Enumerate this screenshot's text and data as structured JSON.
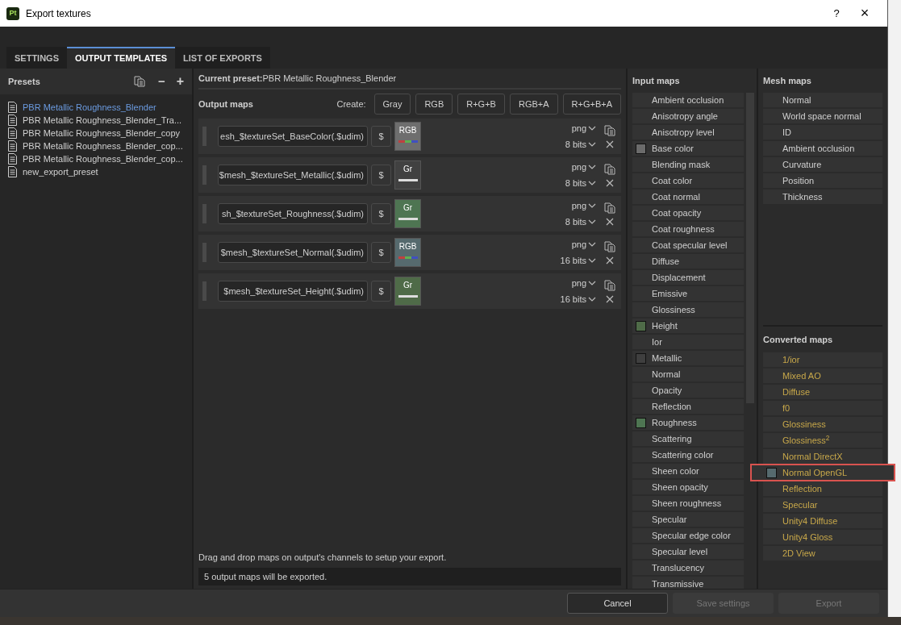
{
  "window": {
    "app_badge": "Pt",
    "title": "Export textures",
    "help": "?",
    "close": "×"
  },
  "tabs": [
    {
      "label": "SETTINGS",
      "selected": false
    },
    {
      "label": "OUTPUT TEMPLATES",
      "selected": true
    },
    {
      "label": "LIST OF EXPORTS",
      "selected": false
    }
  ],
  "presets": {
    "title": "Presets",
    "minus": "−",
    "plus": "+",
    "items": [
      {
        "label": "PBR Metallic Roughness_Blender",
        "selected": true
      },
      {
        "label": "PBR Metallic Roughness_Blender_Tra...",
        "selected": false
      },
      {
        "label": "PBR Metallic Roughness_Blender_copy",
        "selected": false
      },
      {
        "label": "PBR Metallic Roughness_Blender_cop...",
        "selected": false
      },
      {
        "label": "PBR Metallic Roughness_Blender_cop...",
        "selected": false
      },
      {
        "label": "new_export_preset",
        "selected": false
      }
    ]
  },
  "current_preset": {
    "label": "Current preset:",
    "value": "PBR Metallic Roughness_Blender"
  },
  "output_maps": {
    "title": "Output maps",
    "create_label": "Create:",
    "create_buttons": [
      "Gray",
      "RGB",
      "R+G+B",
      "RGB+A",
      "R+G+B+A"
    ],
    "maps": [
      {
        "name": "esh_$textureSet_BaseColor(.$udim)",
        "dollar": "$",
        "kind": "rgb",
        "channel": "RGB",
        "color": "#6e6e6e",
        "format": "png",
        "bits": "8 bits"
      },
      {
        "name": "$mesh_$textureSet_Metallic(.$udim)",
        "dollar": "$",
        "kind": "gray",
        "channel": "Gr",
        "color": "#414141",
        "format": "png",
        "bits": "8 bits"
      },
      {
        "name": "sh_$textureSet_Roughness(.$udim)",
        "dollar": "$",
        "kind": "gray",
        "channel": "Gr",
        "color": "#4e7552",
        "format": "png",
        "bits": "8 bits"
      },
      {
        "name": "$mesh_$textureSet_Normal(.$udim)",
        "dollar": "$",
        "kind": "rgb",
        "channel": "RGB",
        "color": "#566a6e",
        "format": "png",
        "bits": "16 bits"
      },
      {
        "name": "$mesh_$textureSet_Height(.$udim)",
        "dollar": "$",
        "kind": "gray",
        "channel": "Gr",
        "color": "#4f6b48",
        "format": "png",
        "bits": "16 bits"
      }
    ],
    "hint": "Drag and drop maps on output's channels to setup your export.",
    "status": "5 output maps will be exported."
  },
  "input_maps": {
    "title": "Input maps",
    "items": [
      {
        "label": "Ambient occlusion"
      },
      {
        "label": "Anisotropy angle"
      },
      {
        "label": "Anisotropy level"
      },
      {
        "label": "Base color",
        "color": "#6b6b6b"
      },
      {
        "label": "Blending mask"
      },
      {
        "label": "Coat color"
      },
      {
        "label": "Coat normal"
      },
      {
        "label": "Coat opacity"
      },
      {
        "label": "Coat roughness"
      },
      {
        "label": "Coat specular level"
      },
      {
        "label": "Diffuse"
      },
      {
        "label": "Displacement"
      },
      {
        "label": "Emissive"
      },
      {
        "label": "Glossiness"
      },
      {
        "label": "Height",
        "color": "#4f6b48"
      },
      {
        "label": "Ior"
      },
      {
        "label": "Metallic",
        "color": "#3f3f3f"
      },
      {
        "label": "Normal"
      },
      {
        "label": "Opacity"
      },
      {
        "label": "Reflection"
      },
      {
        "label": "Roughness",
        "color": "#4e7552"
      },
      {
        "label": "Scattering"
      },
      {
        "label": "Scattering color"
      },
      {
        "label": "Sheen color"
      },
      {
        "label": "Sheen opacity"
      },
      {
        "label": "Sheen roughness"
      },
      {
        "label": "Specular"
      },
      {
        "label": "Specular edge color"
      },
      {
        "label": "Specular level"
      },
      {
        "label": "Translucency"
      },
      {
        "label": "Transmissive"
      }
    ]
  },
  "mesh_maps": {
    "title": "Mesh maps",
    "items": [
      "Normal",
      "World space normal",
      "ID",
      "Ambient occlusion",
      "Curvature",
      "Position",
      "Thickness"
    ]
  },
  "converted_maps": {
    "title": "Converted maps",
    "items": [
      {
        "label": "1/ior",
        "highlighted": false
      },
      {
        "label": "Mixed AO",
        "highlighted": false
      },
      {
        "label": "Diffuse",
        "highlighted": false
      },
      {
        "label": "f0",
        "highlighted": false
      },
      {
        "label": "Glossiness",
        "highlighted": false
      },
      {
        "label": "Glossiness$^{2}$",
        "highlighted": false
      },
      {
        "label": "Normal DirectX",
        "highlighted": false
      },
      {
        "label": "Normal OpenGL",
        "highlighted": true,
        "color": "#566a6e"
      },
      {
        "label": "Reflection",
        "highlighted": false
      },
      {
        "label": "Specular",
        "highlighted": false
      },
      {
        "label": "Unity4 Diffuse",
        "highlighted": false
      },
      {
        "label": "Unity4 Gloss",
        "highlighted": false
      },
      {
        "label": "2D View",
        "highlighted": false
      }
    ]
  },
  "footer": [
    {
      "label": "Cancel",
      "disabled": false
    },
    {
      "label": "Save settings",
      "disabled": true
    },
    {
      "label": "Export",
      "disabled": true
    }
  ]
}
